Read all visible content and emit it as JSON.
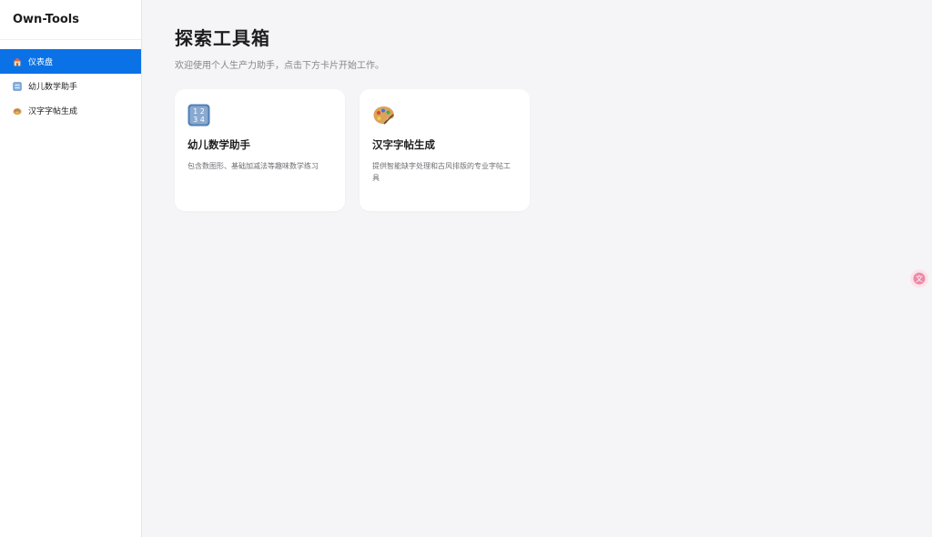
{
  "sidebar": {
    "brand": "Own-Tools",
    "items": [
      {
        "label": "仪表盘",
        "icon": "house-icon",
        "active": true
      },
      {
        "label": "幼儿数学助手",
        "icon": "numbers-icon",
        "active": false
      },
      {
        "label": "汉字字帖生成",
        "icon": "palette-icon",
        "active": false
      }
    ]
  },
  "main": {
    "title": "探索工具箱",
    "subtitle": "欢迎使用个人生产力助手，点击下方卡片开始工作。",
    "cards": [
      {
        "title": "幼儿数学助手",
        "description": "包含数图形、基础加减法等趣味数学练习",
        "icon": "numbers-icon"
      },
      {
        "title": "汉字字帖生成",
        "description": "提供智能缺字处理和古风排版的专业字帖工具",
        "icon": "palette-icon"
      }
    ]
  },
  "floating_button": {
    "icon": "translate-icon"
  },
  "colors": {
    "accent": "#0a72e6",
    "background": "#f5f5f7",
    "card": "#ffffff"
  }
}
